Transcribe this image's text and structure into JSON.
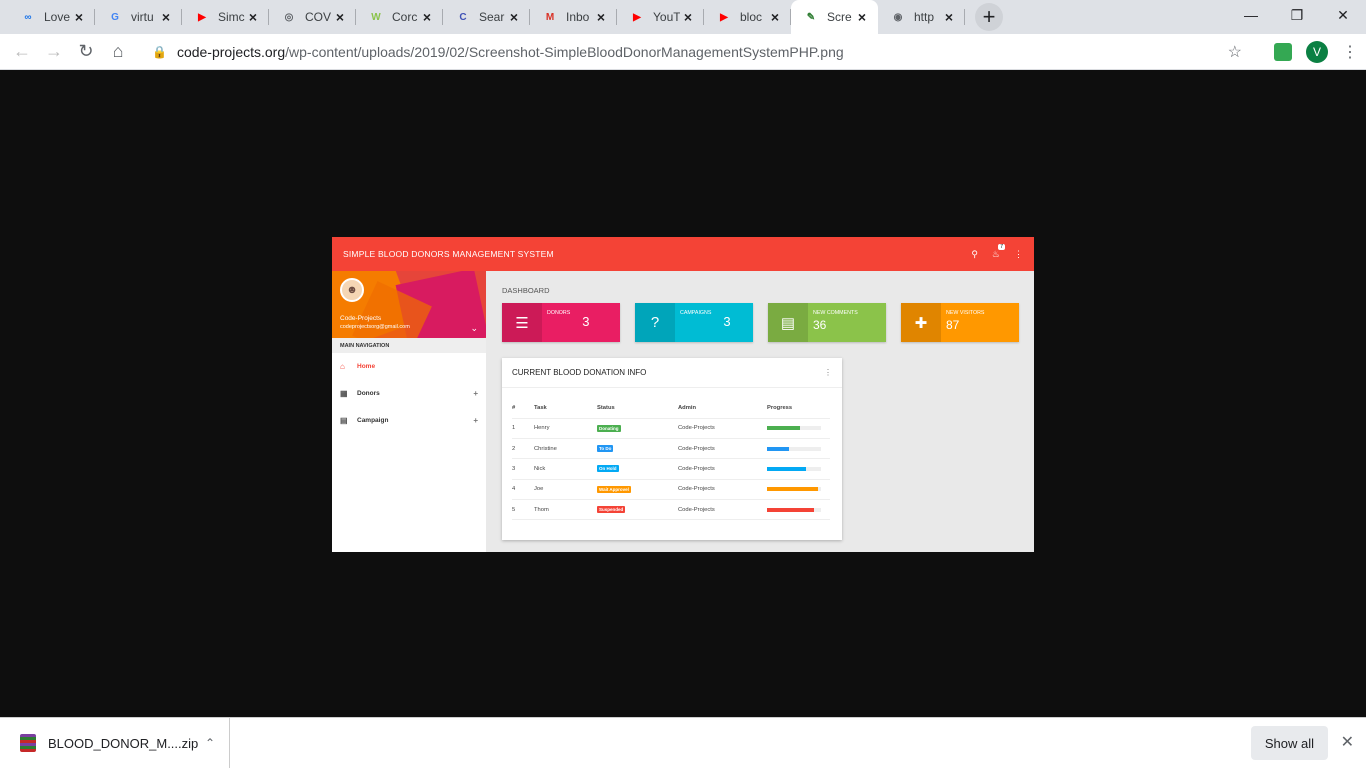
{
  "browser": {
    "tabs": [
      {
        "title": "Love",
        "icon": "infinity-icon",
        "icon_glyph": "∞",
        "icon_color": "#1a73e8"
      },
      {
        "title": "virtu",
        "icon": "google-icon",
        "icon_glyph": "G",
        "icon_color": "#4285f4"
      },
      {
        "title": "Simc",
        "icon": "youtube-icon",
        "icon_glyph": "▶",
        "icon_color": "#ff0000"
      },
      {
        "title": "COV",
        "icon": "globe-icon",
        "icon_glyph": "◎",
        "icon_color": "#5f6368"
      },
      {
        "title": "Corc",
        "icon": "w-icon",
        "icon_glyph": "W",
        "icon_color": "#8bc34a"
      },
      {
        "title": "Sear",
        "icon": "c-icon",
        "icon_glyph": "C",
        "icon_color": "#3f51b5"
      },
      {
        "title": "Inbo",
        "icon": "gmail-icon",
        "icon_glyph": "M",
        "icon_color": "#d93025"
      },
      {
        "title": "YouT",
        "icon": "youtube-icon",
        "icon_glyph": "▶",
        "icon_color": "#ff0000"
      },
      {
        "title": "bloc",
        "icon": "youtube-icon",
        "icon_glyph": "▶",
        "icon_color": "#ff0000"
      },
      {
        "title": "Scre",
        "icon": "leaf-icon",
        "icon_glyph": "✎",
        "icon_color": "#2e7d32",
        "active": true
      },
      {
        "title": "http",
        "icon": "globe-icon",
        "icon_glyph": "◉",
        "icon_color": "#5f6368"
      }
    ],
    "url_host": "code-projects.org",
    "url_path": "/wp-content/uploads/2019/02/Screenshot-SimpleBloodDonorManagementSystemPHP.png",
    "profile_initial": "V"
  },
  "app": {
    "brand": "SIMPLE BLOOD DONORS MANAGEMENT SYSTEM",
    "notif_count": "7",
    "user_name": "Code-Projects",
    "user_email": "codeprojectsorg@gmail.com",
    "nav_header": "MAIN NAVIGATION",
    "nav": [
      {
        "label": "Home",
        "icon": "home-icon"
      },
      {
        "label": "Donors",
        "icon": "grid-icon"
      },
      {
        "label": "Campaign",
        "icon": "clipboard-icon"
      }
    ],
    "dashboard_title": "DASHBOARD",
    "cards": [
      {
        "label": "DONORS",
        "value": "3",
        "color": "#e91e63",
        "icon": "checklist-icon"
      },
      {
        "label": "CAMPAIGNS",
        "value": "3",
        "color": "#00bcd4",
        "icon": "help-icon"
      },
      {
        "label": "NEW COMMENTS",
        "value": "36",
        "color": "#8bc34a",
        "icon": "forum-icon"
      },
      {
        "label": "NEW VISITORS",
        "value": "87",
        "color": "#ff9800",
        "icon": "person-add-icon"
      }
    ],
    "panel_title": "CURRENT BLOOD DONATION INFO",
    "table_headers": [
      "#",
      "Task",
      "Status",
      "Admin",
      "Progress"
    ],
    "rows": [
      {
        "num": "1",
        "task": "Henry",
        "status": "Donating",
        "status_color": "#4caf50",
        "admin": "Code-Projects",
        "progress": 0.62
      },
      {
        "num": "2",
        "task": "Christine",
        "status": "To Do",
        "status_color": "#2196f3",
        "admin": "Code-Projects",
        "progress": 0.4
      },
      {
        "num": "3",
        "task": "Nick",
        "status": "On Hold",
        "status_color": "#03a9f4",
        "admin": "Code-Projects",
        "progress": 0.72
      },
      {
        "num": "4",
        "task": "Joe",
        "status": "Wait Approvel",
        "status_color": "#ff9800",
        "admin": "Code-Projects",
        "progress": 0.95
      },
      {
        "num": "5",
        "task": "Thom",
        "status": "Suspended",
        "status_color": "#f44336",
        "admin": "Code-Projects",
        "progress": 0.87
      }
    ]
  },
  "downloads": {
    "file_name": "BLOOD_DONOR_M....zip",
    "show_all": "Show all"
  }
}
